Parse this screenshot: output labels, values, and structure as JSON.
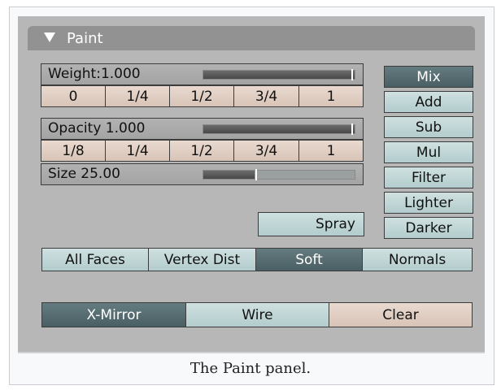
{
  "panel": {
    "title": "Paint",
    "weight_label": "Weight:1.000",
    "weight_value": 1.0,
    "weight_presets": [
      "0",
      "1/4",
      "1/2",
      "3/4",
      "1"
    ],
    "opacity_label": "Opacity 1.000",
    "opacity_value": 1.0,
    "opacity_presets": [
      "1/8",
      "1/4",
      "1/2",
      "3/4",
      "1"
    ],
    "size_label": "Size 25.00",
    "size_value": 0.34,
    "spray_label": "Spray",
    "blend_modes": [
      "Mix",
      "Add",
      "Sub",
      "Mul",
      "Filter",
      "Lighter",
      "Darker"
    ],
    "active_blend_mode": "Mix",
    "options": [
      "All Faces",
      "Vertex Dist",
      "Soft",
      "Normals"
    ],
    "active_option": "Soft",
    "bottom": {
      "xmirror_label": "X-Mirror",
      "wire_label": "Wire",
      "clear_label": "Clear"
    }
  },
  "caption": "The Paint panel."
}
